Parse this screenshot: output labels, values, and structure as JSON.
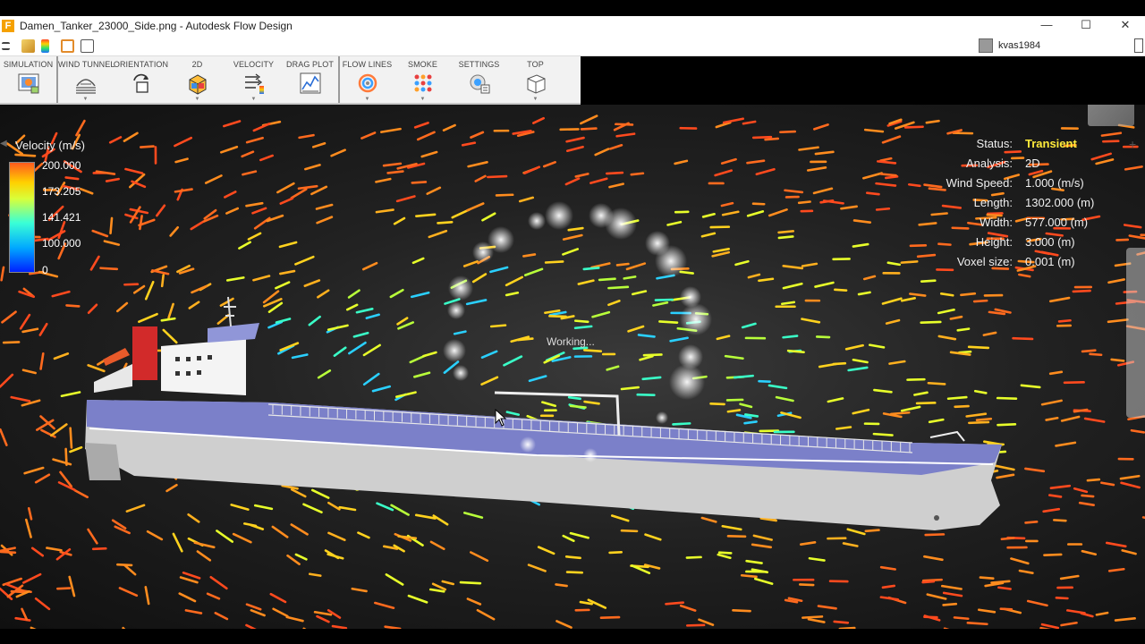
{
  "window": {
    "app_icon": "F",
    "title": "Damen_Tanker_23000_Side.png - Autodesk Flow Design",
    "minimize": "—",
    "maximize": "☐",
    "close": "✕"
  },
  "user": {
    "name": "kvas1984"
  },
  "ribbon": [
    {
      "id": "simulation",
      "label": "SIMULATION",
      "icon": "simulation-icon"
    },
    {
      "id": "wind-tunnel",
      "label": "WIND TUNNEL",
      "icon": "wind-tunnel-icon"
    },
    {
      "id": "orientation",
      "label": "ORIENTATION",
      "icon": "rotate-icon"
    },
    {
      "id": "2d",
      "label": "2D",
      "icon": "2d-cube-icon"
    },
    {
      "id": "velocity",
      "label": "VELOCITY",
      "icon": "velocity-icon"
    },
    {
      "id": "drag-plot",
      "label": "DRAG PLOT",
      "icon": "drag-plot-icon"
    },
    {
      "id": "flow-lines",
      "label": "FLOW LINES",
      "icon": "flow-lines-icon"
    },
    {
      "id": "smoke",
      "label": "SMOKE",
      "icon": "smoke-icon"
    },
    {
      "id": "settings",
      "label": "SETTINGS",
      "icon": "settings-icon"
    },
    {
      "id": "top",
      "label": "TOP",
      "icon": "top-view-cube-icon"
    }
  ],
  "legend": {
    "title": "Velocity (m/s)",
    "values": [
      "200.000",
      "173.205",
      "141.421",
      "100.000",
      "0"
    ]
  },
  "status": {
    "rows": [
      {
        "key": "Status:",
        "value": "Transient"
      },
      {
        "key": "Analysis:",
        "value": "2D"
      },
      {
        "key": "Wind Speed:",
        "value": "1.000 (m/s)"
      },
      {
        "key": "Length:",
        "value": "1302.000 (m)"
      },
      {
        "key": "Width:",
        "value": "577.000 (m)"
      },
      {
        "key": "Height:",
        "value": "3.000 (m)"
      },
      {
        "key": "Voxel size:",
        "value": "0.001 (m)"
      }
    ]
  },
  "viewport": {
    "working_text": "Working...",
    "view_cube_label": "TOP"
  },
  "colors": {
    "transient": "#ffeb3b",
    "hull": "#d2d2d2",
    "deck": "#7b80c9",
    "velocity_high": "#ff5a1e",
    "velocity_low": "#0020ff"
  }
}
